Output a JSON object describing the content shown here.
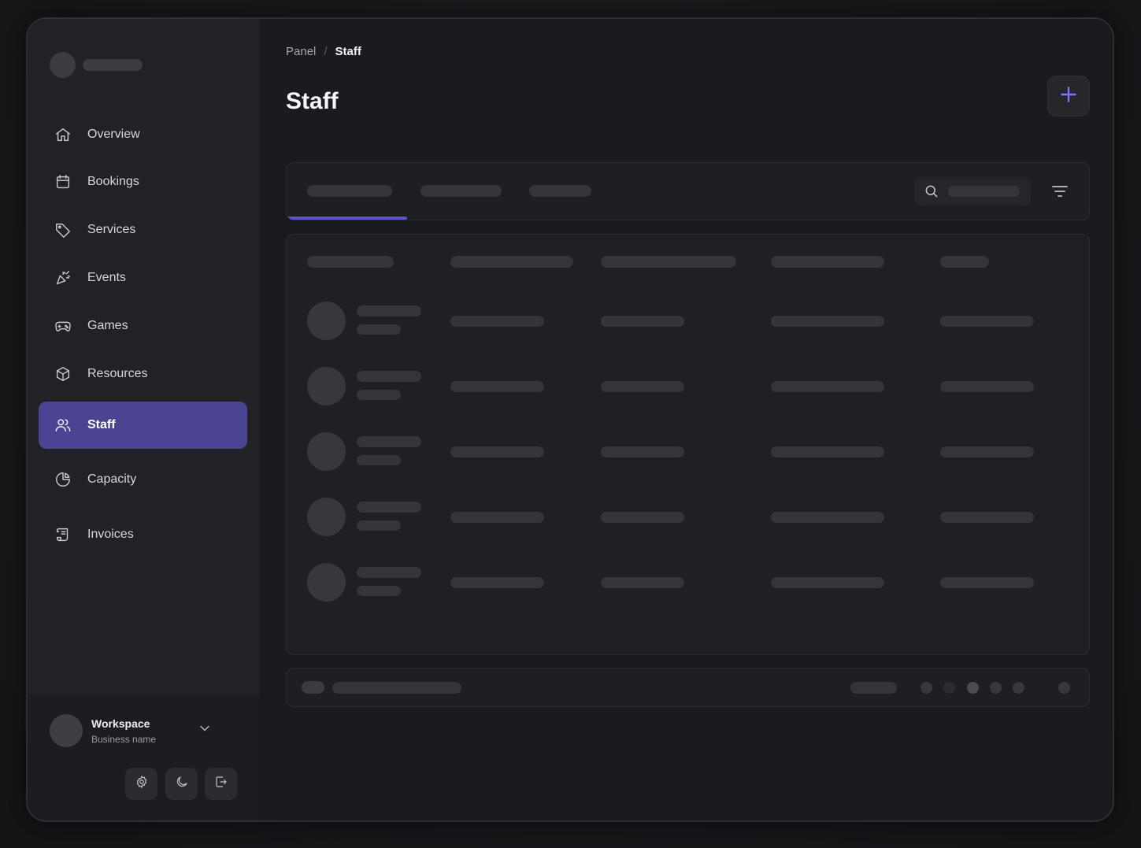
{
  "breadcrumb": {
    "root": "Panel",
    "separator": "/",
    "current": "Staff"
  },
  "page": {
    "title": "Staff"
  },
  "sidebar": {
    "items": [
      {
        "label": "Overview",
        "icon": "home-icon"
      },
      {
        "label": "Bookings",
        "icon": "calendar-icon"
      },
      {
        "label": "Services",
        "icon": "tag-icon"
      },
      {
        "label": "Events",
        "icon": "party-popper-icon"
      },
      {
        "label": "Games",
        "icon": "gamepad-icon"
      },
      {
        "label": "Resources",
        "icon": "box-icon"
      },
      {
        "label": "Staff",
        "icon": "users-icon",
        "active": true
      },
      {
        "label": "Capacity",
        "icon": "pie-chart-icon"
      },
      {
        "label": "Invoices",
        "icon": "receipt-icon"
      }
    ]
  },
  "workspace": {
    "name": "Workspace",
    "subtitle": "Business name"
  },
  "colors": {
    "accent": "#5a52d8",
    "active_nav": "#4a4492",
    "add_icon": "#7f73ff"
  }
}
